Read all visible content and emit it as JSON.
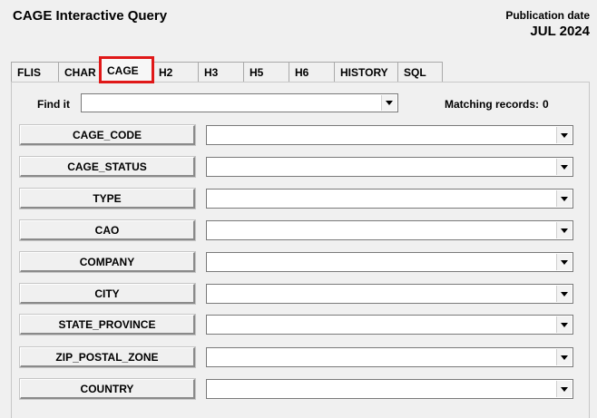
{
  "window": {
    "title": "CAGE Interactive Query",
    "publication_label": "Publication date",
    "publication_value": "JUL 2024"
  },
  "tabs": [
    {
      "label": "FLIS",
      "active": false
    },
    {
      "label": "CHAR",
      "active": false
    },
    {
      "label": "CAGE",
      "active": true
    },
    {
      "label": "H2",
      "active": false
    },
    {
      "label": "H3",
      "active": false
    },
    {
      "label": "H5",
      "active": false
    },
    {
      "label": "H6",
      "active": false
    },
    {
      "label": "HISTORY",
      "active": false
    },
    {
      "label": "SQL",
      "active": false
    }
  ],
  "find": {
    "label": "Find it",
    "value": ""
  },
  "matching": {
    "label": "Matching records:",
    "count": "0"
  },
  "fields": [
    {
      "label": "CAGE_CODE",
      "value": ""
    },
    {
      "label": "CAGE_STATUS",
      "value": ""
    },
    {
      "label": "TYPE",
      "value": ""
    },
    {
      "label": "CAO",
      "value": ""
    },
    {
      "label": "COMPANY",
      "value": ""
    },
    {
      "label": "CITY",
      "value": ""
    },
    {
      "label": "STATE_PROVINCE",
      "value": ""
    },
    {
      "label": "ZIP_POSTAL_ZONE",
      "value": ""
    },
    {
      "label": "COUNTRY",
      "value": ""
    }
  ],
  "colors": {
    "highlight": "#e01818",
    "background": "#f0f0f0"
  },
  "icons": {
    "dropdown": "chevron-down-icon"
  }
}
